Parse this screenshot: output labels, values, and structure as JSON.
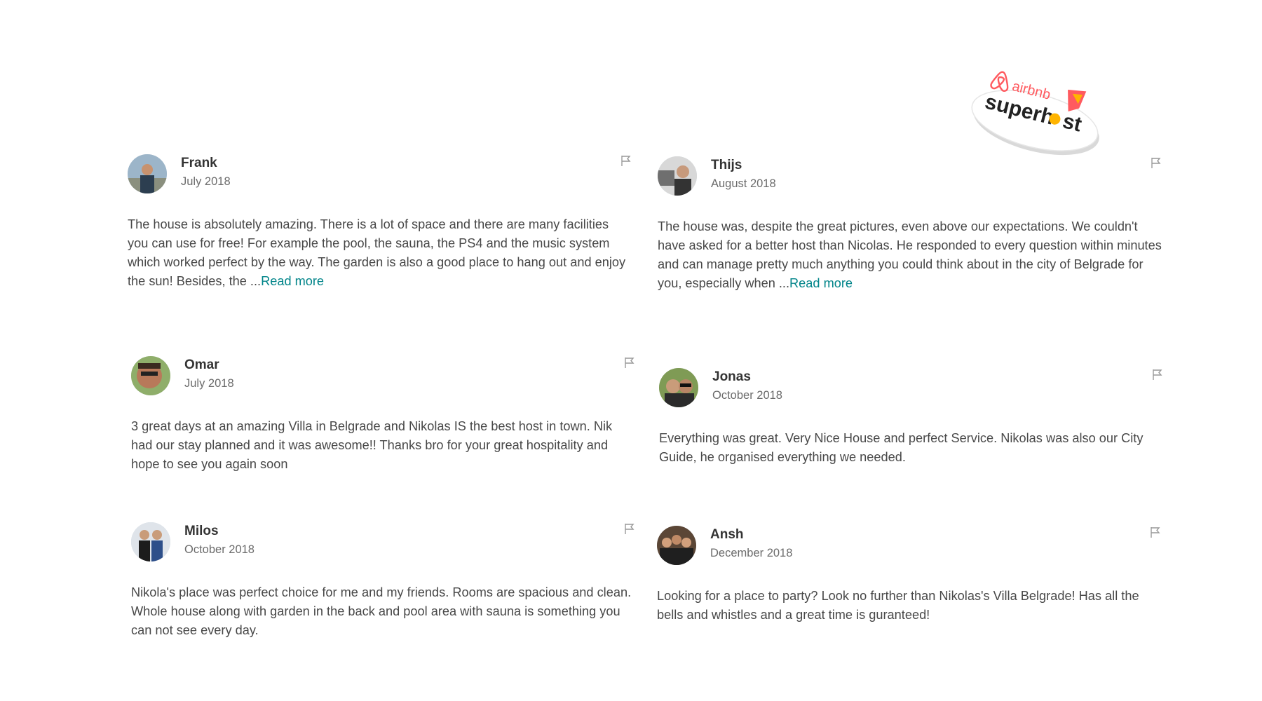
{
  "badge": {
    "brand": "airbnb",
    "title_prefix": "superh",
    "title_suffix": "st",
    "brand_color": "#ff5a5f",
    "accent_color": "#ffb400"
  },
  "colors": {
    "text": "#484848",
    "muted": "#6b6b6b",
    "link": "#008489"
  },
  "read_more_label": "Read more",
  "reviews": [
    {
      "name": "Frank",
      "date": "July 2018",
      "text": "The house is absolutely amazing. There is a lot of space and there are many facilities you can use for free! For example the pool, the sauna, the PS4 and the music system which worked perfect by the way. The garden is also a good place to hang out and enjoy the sun! Besides, the ...",
      "read_more": "Read more",
      "flag_icon": "flag-icon"
    },
    {
      "name": "Thijs",
      "date": "August 2018",
      "text": "The house was, despite the great pictures, even above our expectations. We couldn't have asked for a better host than Nicolas. He responded to every question within minutes and can manage pretty much anything you could think about in the city of Belgrade for you, especially when ...",
      "read_more": "Read more",
      "flag_icon": "flag-icon"
    },
    {
      "name": "Omar",
      "date": "July 2018",
      "text": "3 great days at an amazing Villa in Belgrade and Nikolas IS the best host in town. Nik had our stay planned and it was awesome!! Thanks bro for your great hospitality and hope to see you again soon",
      "flag_icon": "flag-icon"
    },
    {
      "name": "Jonas",
      "date": "October 2018",
      "text": "Everything was great. Very Nice House and perfect Service. Nikolas was also our City Guide, he organised everything we needed.",
      "flag_icon": "flag-icon"
    },
    {
      "name": "Milos",
      "date": "October 2018",
      "text": "Nikola's place was perfect choice for me and my friends. Rooms are spacious and clean. Whole house along with garden in the back and pool area with sauna is something you can not see every day.",
      "flag_icon": "flag-icon"
    },
    {
      "name": "Ansh",
      "date": "December 2018",
      "text": "Looking for a place to party? Look no further than Nikolas's Villa Belgrade! Has all the bells and whistles and a great time is guranteed!",
      "flag_icon": "flag-icon"
    }
  ]
}
